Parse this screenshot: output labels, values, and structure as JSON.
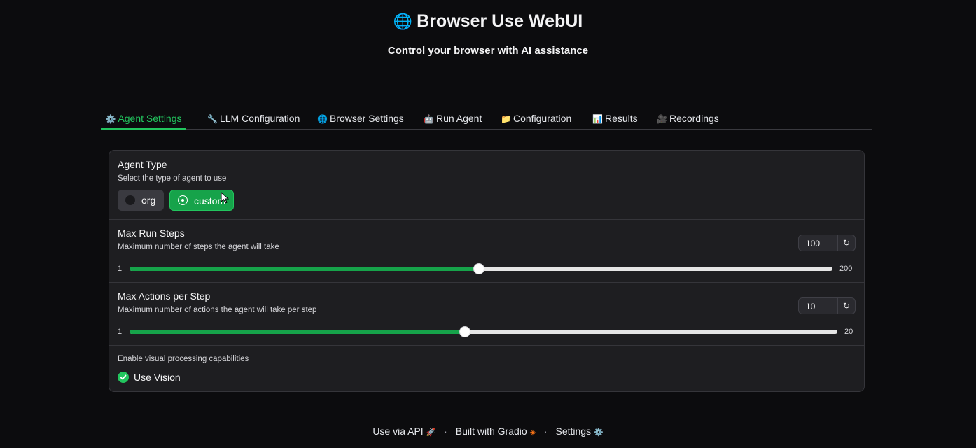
{
  "header": {
    "title": "Browser Use WebUI",
    "title_icon": "globe-icon",
    "subtitle": "Control your browser with AI assistance"
  },
  "tabs": [
    {
      "label": "Agent Settings",
      "icon": "gear-icon",
      "active": true
    },
    {
      "label": "LLM Configuration",
      "icon": "wrench-icon"
    },
    {
      "label": "Browser Settings",
      "icon": "globe-icon"
    },
    {
      "label": "Run Agent",
      "icon": "robot-icon"
    },
    {
      "label": "Configuration",
      "icon": "folder-icon"
    },
    {
      "label": "Results",
      "icon": "bar-chart-icon"
    },
    {
      "label": "Recordings",
      "icon": "film-icon"
    }
  ],
  "agent_type": {
    "label": "Agent Type",
    "info": "Select the type of agent to use",
    "options": [
      "org",
      "custom"
    ],
    "selected": "custom"
  },
  "max_run_steps": {
    "label": "Max Run Steps",
    "info": "Maximum number of steps the agent will take",
    "value": "100",
    "min": "1",
    "max": "200"
  },
  "max_actions": {
    "label": "Max Actions per Step",
    "info": "Maximum number of actions the agent will take per step",
    "value": "10",
    "min": "1",
    "max": "20"
  },
  "vision": {
    "info": "Enable visual processing capabilities",
    "label": "Use Vision",
    "checked": true
  },
  "footer": {
    "api": "Use via API",
    "built": "Built with Gradio",
    "settings": "Settings"
  },
  "colors": {
    "accent": "#22c55e",
    "slider_fill": "#16a34a",
    "background": "#0c0c0e",
    "panel": "#1e1e21"
  }
}
